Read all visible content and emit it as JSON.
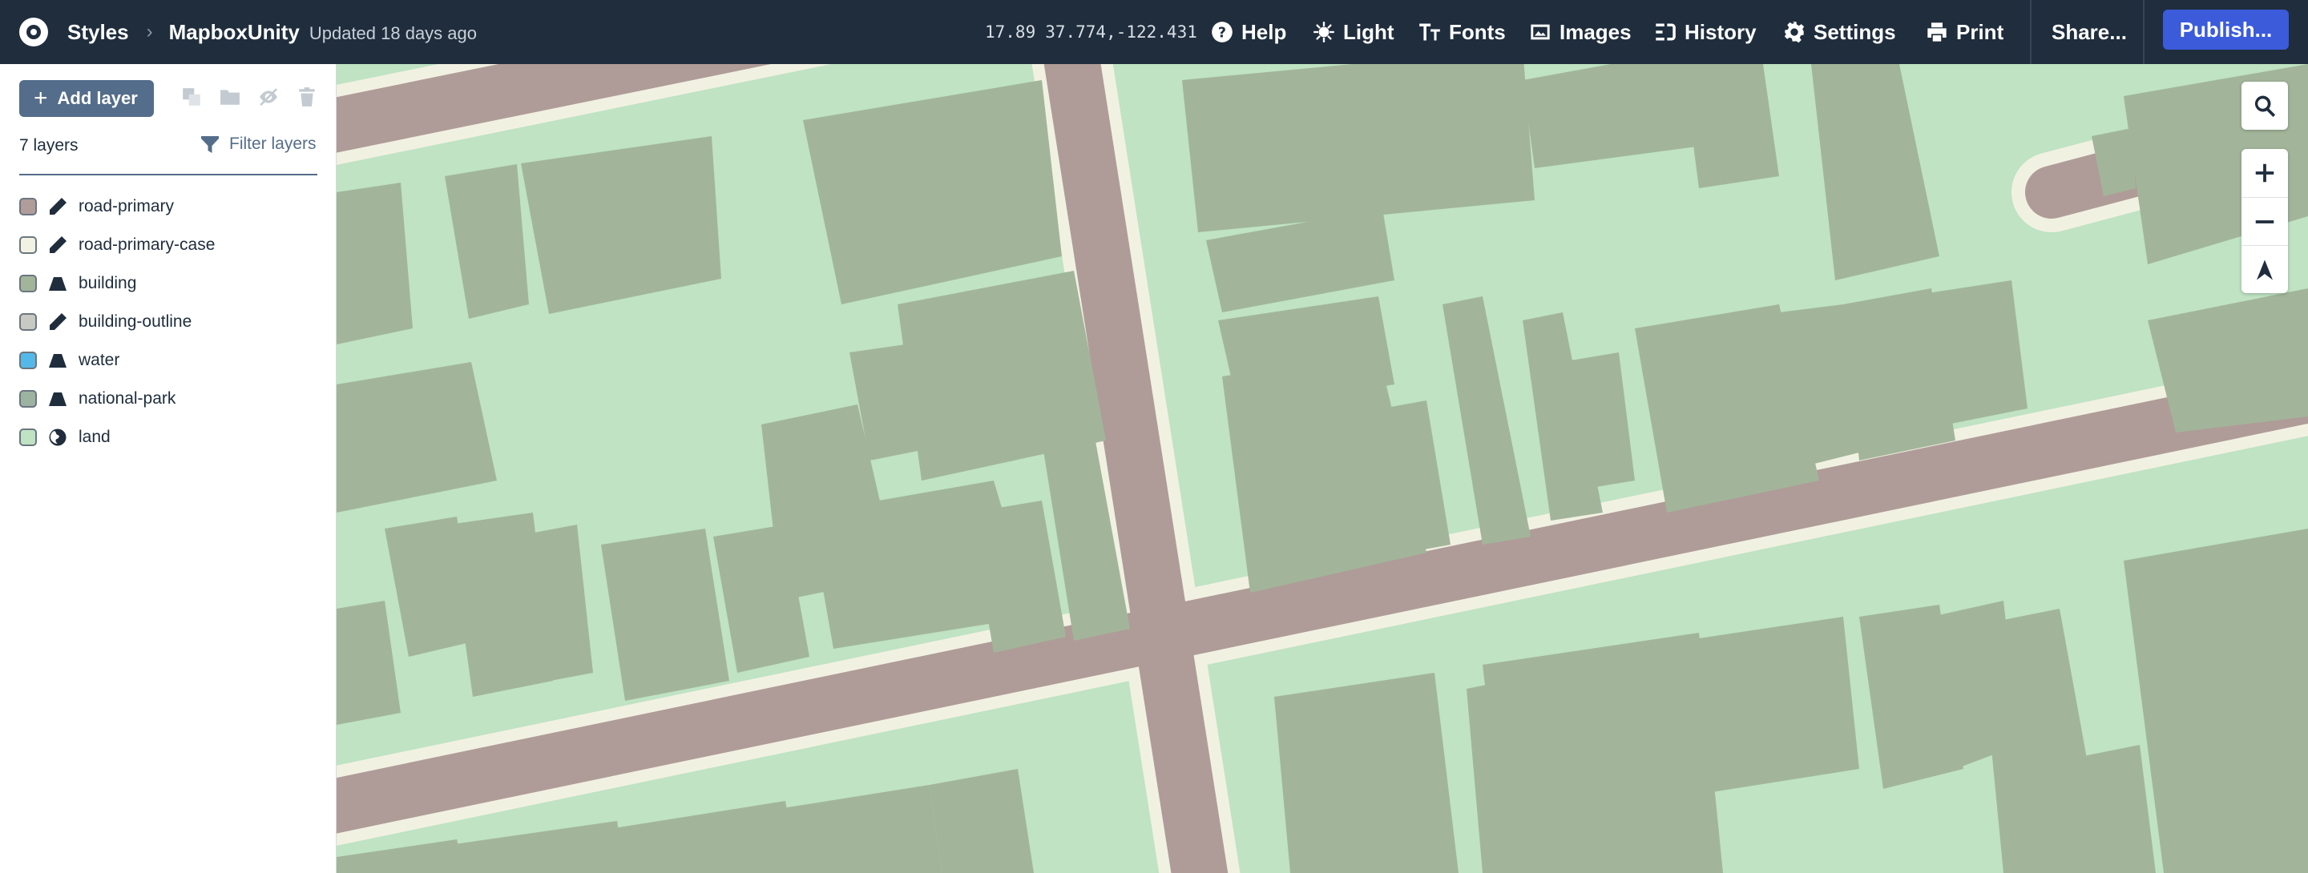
{
  "header": {
    "breadcrumb_root": "Styles",
    "style_name": "MapboxUnity",
    "updated": "Updated 18 days ago",
    "zoom": "17.89",
    "coordinates": "37.774,-122.431",
    "nav": {
      "help": "Help",
      "light": "Light",
      "fonts": "Fonts",
      "images": "Images",
      "history": "History",
      "settings": "Settings",
      "print": "Print",
      "share": "Share...",
      "publish": "Publish..."
    }
  },
  "sidebar": {
    "add_layer": "Add layer",
    "layer_count": "7 layers",
    "filter_layers": "Filter layers",
    "layers": [
      {
        "name": "road-primary",
        "type": "line",
        "color": "#b09c9a"
      },
      {
        "name": "road-primary-case",
        "type": "line",
        "color": "#f2f2e4"
      },
      {
        "name": "building",
        "type": "fill",
        "color": "#a2b59a"
      },
      {
        "name": "building-outline",
        "type": "line",
        "color": "#c9c9c3"
      },
      {
        "name": "water",
        "type": "fill",
        "color": "#54b8e8"
      },
      {
        "name": "national-park",
        "type": "fill",
        "color": "#9db3a2"
      },
      {
        "name": "land",
        "type": "background",
        "color": "#bfe3c3"
      }
    ]
  },
  "map": {
    "colors": {
      "land": "#bfe3c3",
      "road": "#af9c98",
      "road_case": "#f1f1e2",
      "building": "#a2b59a"
    }
  }
}
